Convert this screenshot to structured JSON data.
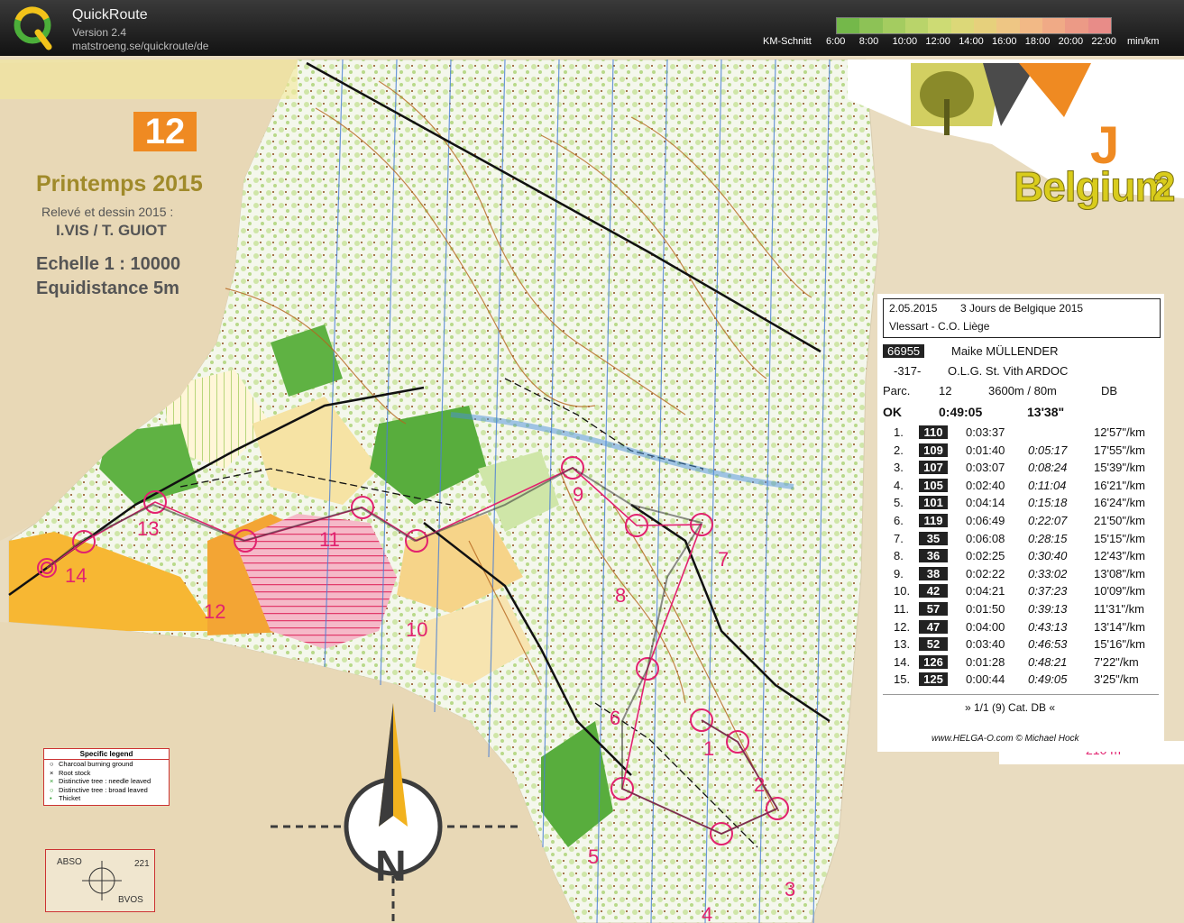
{
  "header": {
    "app_name": "QuickRoute",
    "version": "Version 2.4",
    "url": "matstroeng.se/quickroute/de",
    "pace_label": "KM-Schnitt",
    "pace_ticks": [
      "6:00",
      "8:00",
      "10:00",
      "12:00",
      "14:00",
      "16:00",
      "18:00",
      "20:00",
      "22:00"
    ],
    "pace_unit": "min/km",
    "pace_colors": [
      "#74b84a",
      "#8dc256",
      "#a4cc60",
      "#b9d46a",
      "#cddb74",
      "#dcd878",
      "#e6d07c",
      "#eec684",
      "#f2b986",
      "#f0aa86",
      "#ec9a86",
      "#e88c88"
    ]
  },
  "map": {
    "course_badge": "12",
    "title": "Printemps 2015",
    "surveyed": "Relevé et dessin 2015 :",
    "authors": "I.VIS / T. GUIOT",
    "scale": "Echelle  1 : 10000",
    "equidistance": "Equidistance  5m",
    "brand_word": "Belgium",
    "brand_num": "J",
    "brand_num2": "2",
    "legend": {
      "title": "Specific legend",
      "items": [
        {
          "symbol": "○",
          "label": "Charcoal burning ground"
        },
        {
          "symbol": "×",
          "label": "Root stock"
        },
        {
          "symbol": "×",
          "label": "Distinctive tree : needle leaved"
        },
        {
          "symbol": "○",
          "label": "Distinctive tree : broad leaved"
        },
        {
          "symbol": "•",
          "label": "Thicket"
        }
      ]
    },
    "abso": {
      "tl": "ABSO",
      "tr": "221",
      "br": "BVOS"
    },
    "north_letter": "N",
    "controls": [
      {
        "label": "1"
      },
      {
        "label": "2"
      },
      {
        "label": "3"
      },
      {
        "label": "4"
      },
      {
        "label": "5"
      },
      {
        "label": "6"
      },
      {
        "label": "7"
      },
      {
        "label": "8"
      },
      {
        "label": "9"
      },
      {
        "label": "10"
      },
      {
        "label": "11"
      },
      {
        "label": "12"
      },
      {
        "label": "13"
      },
      {
        "label": "14"
      }
    ],
    "tail_text": "210 m"
  },
  "receipt": {
    "date": "2.05.2015",
    "event": "3 Jours de Belgique 2015",
    "venue": "Vlessart - C.O. Liège",
    "runner_id": "66955",
    "runner_name": "Maike MÜLLENDER",
    "club_no": "-317-",
    "club": "O.L.G. St. Vith ARDOC",
    "parc_label": "Parc.",
    "parc": "12",
    "length": "3600m / 80m",
    "category": "DB",
    "status": "OK",
    "total_time": "0:49:05",
    "total_pace": "13'38\"",
    "splits": [
      {
        "n": "1.",
        "code": "110",
        "leg": "0:03:37",
        "cum": "",
        "pace": "12'57\"/km"
      },
      {
        "n": "2.",
        "code": "109",
        "leg": "0:01:40",
        "cum": "0:05:17",
        "pace": "17'55\"/km"
      },
      {
        "n": "3.",
        "code": "107",
        "leg": "0:03:07",
        "cum": "0:08:24",
        "pace": "15'39\"/km"
      },
      {
        "n": "4.",
        "code": "105",
        "leg": "0:02:40",
        "cum": "0:11:04",
        "pace": "16'21\"/km"
      },
      {
        "n": "5.",
        "code": "101",
        "leg": "0:04:14",
        "cum": "0:15:18",
        "pace": "16'24\"/km"
      },
      {
        "n": "6.",
        "code": "119",
        "leg": "0:06:49",
        "cum": "0:22:07",
        "pace": "21'50\"/km"
      },
      {
        "n": "7.",
        "code": "35",
        "leg": "0:06:08",
        "cum": "0:28:15",
        "pace": "15'15\"/km"
      },
      {
        "n": "8.",
        "code": "36",
        "leg": "0:02:25",
        "cum": "0:30:40",
        "pace": "12'43\"/km"
      },
      {
        "n": "9.",
        "code": "38",
        "leg": "0:02:22",
        "cum": "0:33:02",
        "pace": "13'08\"/km"
      },
      {
        "n": "10.",
        "code": "42",
        "leg": "0:04:21",
        "cum": "0:37:23",
        "pace": "10'09\"/km"
      },
      {
        "n": "11.",
        "code": "57",
        "leg": "0:01:50",
        "cum": "0:39:13",
        "pace": "11'31\"/km"
      },
      {
        "n": "12.",
        "code": "47",
        "leg": "0:04:00",
        "cum": "0:43:13",
        "pace": "13'14\"/km"
      },
      {
        "n": "13.",
        "code": "52",
        "leg": "0:03:40",
        "cum": "0:46:53",
        "pace": "15'16\"/km"
      },
      {
        "n": "14.",
        "code": "126",
        "leg": "0:01:28",
        "cum": "0:48:21",
        "pace": "7'22\"/km"
      },
      {
        "n": "15.",
        "code": "125",
        "leg": "0:00:44",
        "cum": "0:49:05",
        "pace": "3'25\"/km"
      }
    ],
    "footer": "» 1/1 (9) Cat. DB «",
    "signature": "www.HELGA-O.com © Michael Hock"
  }
}
